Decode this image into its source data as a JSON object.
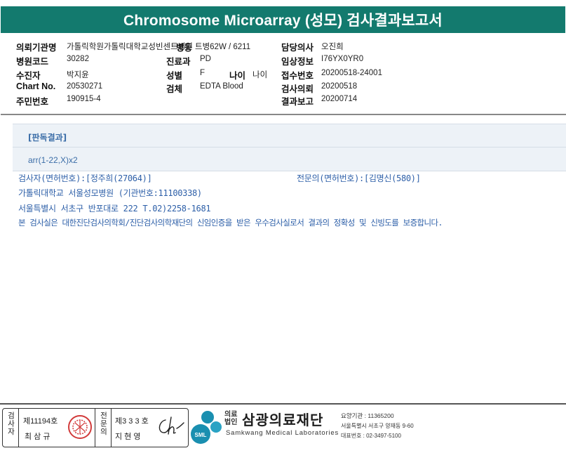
{
  "title": "Chromosome Microarray (성모) 검사결과보고서",
  "info": {
    "requesting_org_label": "의뢰기관명",
    "requesting_org_value": "가톨릭학원가톨릭대학교성빈센트병원",
    "ward_label": "병동",
    "ward_value": "트병62W / 6211",
    "doctor_label": "담당의사",
    "doctor_value": "오진희",
    "hospital_code_label": "병원코드",
    "hospital_code_value": "30282",
    "department_label": "진료과",
    "department_value": "PD",
    "clinical_info_label": "임상정보",
    "clinical_info_value": "I76YX0YR0",
    "patient_label": "수진자",
    "patient_value": "박지윤",
    "sex_label": "성별",
    "sex_value": "F",
    "age_label": "나이",
    "age_value": "나이",
    "receipt_no_label": "접수번호",
    "receipt_no_value": "20200518-24001",
    "chart_label": "Chart No.",
    "chart_value": "20530271",
    "specimen_label": "검체",
    "specimen_value": "EDTA Blood",
    "test_request_label": "검사의뢰",
    "test_request_value": "20200518",
    "resident_no_label": "주민번호",
    "resident_no_value": "190915-4",
    "report_label": "결과보고",
    "report_value": "20200714"
  },
  "result": {
    "heading": "[판독결과]",
    "text": "arr(1-22,X)x2"
  },
  "footer_lines": {
    "examiner": "검사자(면허번호):[정주희(27064)]",
    "specialist": "전문의(면허번호):[김명신(580)]",
    "hospital": "가톨릭대학교 서울성모병원 (기관번호:11100338)",
    "address": "서울특별시 서초구 반포대로 222 T.02)2258-1681",
    "certification": "본 검사실은 대한진단검사의학회/진단검사의학재단의 신임인증을 받은 우수검사실로서 결과의 정확성 및 신빙도를 보증합니다."
  },
  "signature": {
    "examiner_col": "검사자",
    "examiner_no": "제11194호",
    "examiner_name": "최 삼 규",
    "specialist_col": "전문의",
    "specialist_no": "제3 3 3 호",
    "specialist_name": "지 현 영",
    "signature_scribble": "Ch"
  },
  "logo": {
    "corp_top": "의료",
    "corp_bottom": "법인",
    "name_ko": "삼광의료재단",
    "name_en": "Samkwang Medical Laboratories",
    "sml": "SML",
    "org_no": "요양기관 : 11365200",
    "address": "서울특별시 서초구 양재동 9-60",
    "phone": "대표번호 : 02-3497-5100"
  },
  "colors": {
    "title_bg": "#137a6e",
    "blue_text": "#2d5fa8",
    "logo_teal": "#1a8fb0"
  }
}
